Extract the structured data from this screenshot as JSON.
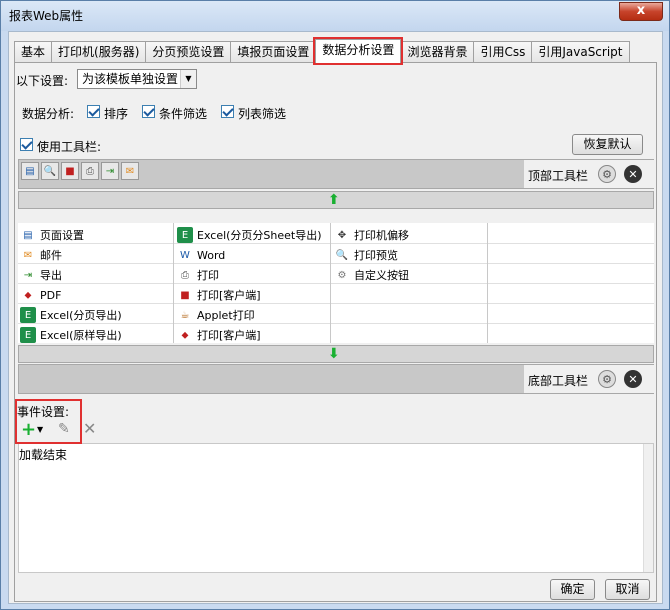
{
  "window": {
    "title": "报表Web属性",
    "close": "x"
  },
  "tabs": [
    "基本",
    "打印机(服务器)",
    "分页预览设置",
    "填报页面设置",
    "数据分析设置",
    "浏览器背景",
    "引用Css",
    "引用JavaScript"
  ],
  "settings": {
    "scope_label": "以下设置:",
    "scope_value": "为该模板单独设置",
    "analysis_label": "数据分析:",
    "options": [
      "排序",
      "条件筛选",
      "列表筛选"
    ],
    "use_toolbar": "使用工具栏:",
    "restore_default": "恢复默认"
  },
  "top_toolbar": {
    "label": "顶部工具栏"
  },
  "bottom_toolbar": {
    "label": "底部工具栏"
  },
  "grid": {
    "col1": [
      "页面设置",
      "邮件",
      "导出",
      "PDF",
      "Excel(分页导出)",
      "Excel(原样导出)"
    ],
    "col2": [
      "Excel(分页分Sheet导出)",
      "Word",
      "打印",
      "打印[客户端]",
      "Applet打印",
      "打印[客户端]"
    ],
    "col3": [
      "打印机偏移",
      "打印预览",
      "自定义按钮"
    ]
  },
  "events": {
    "label": "事件设置:",
    "items": [
      "加载结束"
    ]
  },
  "footer": {
    "ok": "确定",
    "cancel": "取消"
  },
  "colors": {
    "accent_red": "#e03030",
    "arrow_green": "#19b031"
  }
}
